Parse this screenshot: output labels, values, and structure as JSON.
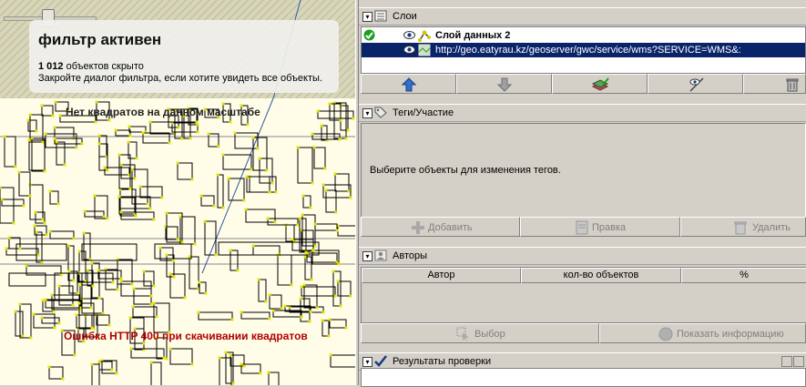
{
  "map": {
    "filter": {
      "title": "фильтр активен",
      "count": "1 012",
      "count_suffix": " объектов скрыто",
      "hint": "Закройте диалог фильтра, если хотите увидеть все объекты."
    },
    "messages": {
      "no_tiles": "Нет квадратов на данном масштабе",
      "http_error": "Ошибка HTTP 400 при скачивании квадратов"
    },
    "colors": {
      "background": "#fffde8",
      "node": "#e6e600",
      "way": "#000000",
      "error": "#b00000"
    }
  },
  "layers_panel": {
    "title": "Слои",
    "layers": [
      {
        "name": "Слой данных 2",
        "active": true,
        "visible": true,
        "icon": "data-layer-icon"
      },
      {
        "name": "http://geo.eatyrau.kz/geoserver/gwc/service/wms?SERVICE=WMS&:",
        "active": false,
        "visible": true,
        "selected": true,
        "icon": "imagery-layer-icon"
      }
    ],
    "buttons": [
      "move-up-icon",
      "move-down-icon",
      "merge-layers-icon",
      "visibility-icon",
      "delete-layer-icon"
    ]
  },
  "tags_panel": {
    "title": "Теги/Участие",
    "empty_message": "Выберите объекты для изменения тегов.",
    "add_label": "Добавить",
    "edit_label": "Правка",
    "delete_label": "Удалить"
  },
  "authors_panel": {
    "title": "Авторы",
    "columns": [
      "Автор",
      "кол-во объектов",
      "%"
    ],
    "select_label": "Выбор",
    "info_label": "Показать информацию"
  },
  "results_panel": {
    "title": "Результаты проверки"
  }
}
